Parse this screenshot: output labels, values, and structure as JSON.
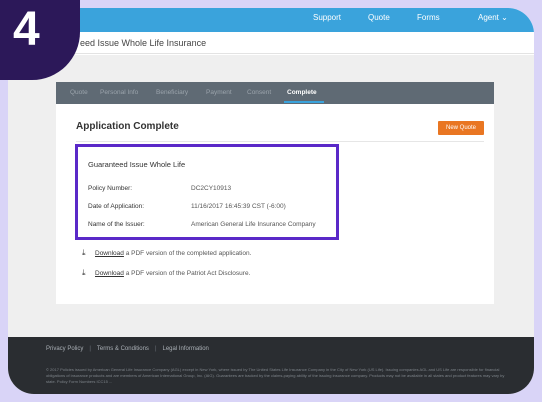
{
  "step_badge": "4",
  "header": {
    "nav": [
      "Support",
      "Quote",
      "Forms",
      "Agent ⌄"
    ],
    "page_title": "eed Issue Whole Life Insurance"
  },
  "tabs": [
    {
      "label": "Quote",
      "active": false
    },
    {
      "label": "Personal Info",
      "active": false
    },
    {
      "label": "Beneficiary",
      "active": false
    },
    {
      "label": "Payment",
      "active": false
    },
    {
      "label": "Consent",
      "active": false
    },
    {
      "label": "Complete",
      "active": true
    }
  ],
  "card": {
    "title": "Application Complete",
    "new_quote_label": "New Quote"
  },
  "summary": {
    "title": "Guaranteed Issue Whole Life",
    "rows": [
      {
        "label": "Policy Number:",
        "value": "DC2CY10913"
      },
      {
        "label": "Date of Application:",
        "value": "11/16/2017 16:45:39 CST (-6:00)"
      },
      {
        "label": "Name of the Issuer:",
        "value": "American General Life Insurance Company"
      }
    ]
  },
  "downloads": [
    {
      "link": "Download",
      "text": " a PDF version of the completed application."
    },
    {
      "link": "Download",
      "text": " a PDF version of the Patriot Act Disclosure."
    }
  ],
  "footer": {
    "links": [
      "Privacy Policy",
      "Terms & Conditions",
      "Legal Information"
    ],
    "legal": "© 2017 Policies issued by American General Life Insurance Company (AGL) except in New York, where issued by The United States Life Insurance Company in the City of New York (US Life). Issuing companies AGL and US Life are responsible for financial obligations of insurance products and are members of American International Group, Inc. (AIG). Guarantees are backed by the claims-paying ability of the issuing insurance company. Products may not be available in all states and product features may vary by state. Policy Form Numbers ICC15 ..."
  },
  "colors": {
    "topbar": "#3aa3dc",
    "tabbar": "#5f6a74",
    "accent_orange": "#e97622",
    "highlight": "#5a29c8",
    "footer": "#2a2d31",
    "badge": "#2c1859",
    "backdrop": "#d9d4f7"
  }
}
